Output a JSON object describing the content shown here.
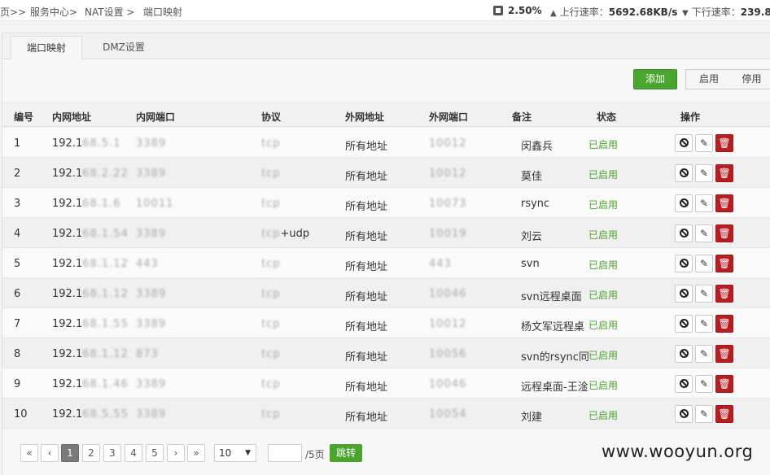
{
  "breadcrumb": {
    "home": "页>>",
    "service": "服务中心>",
    "nat": "NAT设置 >",
    "current": "端口映射"
  },
  "stats": {
    "cpu": "2.50%",
    "up_label": "上行速率：",
    "up_value": "5692.68KB/s",
    "down_label": "下行速率：",
    "down_value": "239.8"
  },
  "tabs": [
    {
      "label": "端口映射"
    },
    {
      "label": "DMZ设置"
    }
  ],
  "toolbar": {
    "add": "添加",
    "enable": "启用",
    "disable": "停用"
  },
  "table": {
    "headers": {
      "no": "编号",
      "lan_ip": "内网地址",
      "lan_port": "内网端口",
      "proto": "协议",
      "wan_ip": "外网地址",
      "wan_port": "外网端口",
      "note": "备注",
      "status": "状态",
      "ops": "操作"
    },
    "rows": [
      {
        "no": "1",
        "lan_ip": "192.1",
        "lan_ip_mask": "68.5.1",
        "lan_port": "3389",
        "proto": "tcp",
        "wan_ip": "所有地址",
        "wan_port": "10012",
        "note": "闵鑫兵",
        "status": "已启用"
      },
      {
        "no": "2",
        "lan_ip": "192.1",
        "lan_ip_mask": "68.2.22",
        "lan_port": "3389",
        "proto": "tcp",
        "wan_ip": "所有地址",
        "wan_port": "10012",
        "note": "莫佳",
        "status": "已启用"
      },
      {
        "no": "3",
        "lan_ip": "192.1",
        "lan_ip_mask": "68.1.6",
        "lan_port": "10011",
        "proto": "tcp",
        "wan_ip": "所有地址",
        "wan_port": "10073",
        "note": "rsync",
        "status": "已启用"
      },
      {
        "no": "4",
        "lan_ip": "192.1",
        "lan_ip_mask": "68.1.54",
        "lan_port": "3389",
        "proto": "tcp",
        "wan_ip": "所有地址",
        "wan_port": "10019",
        "proto_suffix": "+udp",
        "note": "刘云",
        "status": "已启用"
      },
      {
        "no": "5",
        "lan_ip": "192.1",
        "lan_ip_mask": "68.1.12",
        "lan_port": "443",
        "proto": "tcp",
        "wan_ip": "所有地址",
        "wan_port": "443",
        "note": "svn",
        "status": "已启用"
      },
      {
        "no": "6",
        "lan_ip": "192.1",
        "lan_ip_mask": "68.1.12",
        "lan_port": "3389",
        "proto": "tcp",
        "wan_ip": "所有地址",
        "wan_port": "10046",
        "note": "svn远程桌面",
        "status": "已启用"
      },
      {
        "no": "7",
        "lan_ip": "192.1",
        "lan_ip_mask": "68.1.55",
        "lan_port": "3389",
        "proto": "tcp",
        "wan_ip": "所有地址",
        "wan_port": "10012",
        "note": "杨文军远程桌",
        "status": "已启用"
      },
      {
        "no": "8",
        "lan_ip": "192.1",
        "lan_ip_mask": "68.1.12",
        "lan_port": "873",
        "proto": "tcp",
        "wan_ip": "所有地址",
        "wan_port": "10056",
        "note": "svn的rsync同",
        "status": "已启用"
      },
      {
        "no": "9",
        "lan_ip": "192.1",
        "lan_ip_mask": "68.1.46",
        "lan_port": "3389",
        "proto": "tcp",
        "wan_ip": "所有地址",
        "wan_port": "10046",
        "note": "远程桌面-王淦",
        "status": "已启用"
      },
      {
        "no": "10",
        "lan_ip": "192.1",
        "lan_ip_mask": "68.5.55",
        "lan_port": "3389",
        "proto": "tcp",
        "wan_ip": "所有地址",
        "wan_port": "10054",
        "note": "刘建",
        "status": "已启用"
      }
    ]
  },
  "pagination": {
    "pages": [
      "1",
      "2",
      "3",
      "4",
      "5"
    ],
    "current": "1",
    "page_size": "10",
    "total": "/5页",
    "jump": "跳转"
  },
  "watermark": "www.wooyun.org",
  "colors": {
    "green": "#4aa52e",
    "red": "#b81d22"
  },
  "icons": {
    "ban": "ban-icon",
    "edit": "pencil-icon",
    "delete": "trash-icon"
  }
}
